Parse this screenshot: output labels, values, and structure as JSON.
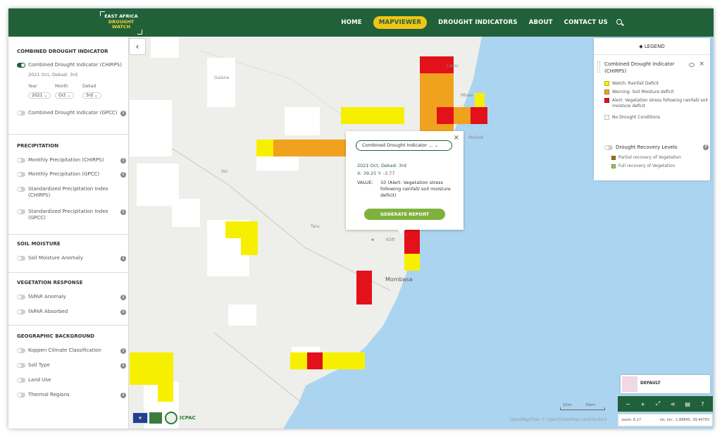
{
  "header": {
    "logo_line1": "EAST AFRICA",
    "logo_line2": "DROUGHT",
    "logo_line3": "WATCH",
    "nav": [
      "HOME",
      "MAPVIEWER",
      "DROUGHT INDICATORS",
      "ABOUT",
      "CONTACT US"
    ],
    "active_nav": "MAPVIEWER",
    "colors": {
      "header_bg": "#21613a",
      "active_bg": "#f2c416"
    }
  },
  "sidebar": {
    "sections": [
      {
        "title": "COMBINED DROUGHT INDICATOR",
        "layers": [
          {
            "label": "Combined Drought Indicator (CHIRPS)",
            "on": true,
            "sub": "2021 Oct, Dekad: 3rd"
          },
          {
            "label": "Combined Drought Indicator (GPCC)",
            "on": false
          }
        ]
      },
      {
        "title": "PRECIPITATION",
        "layers": [
          {
            "label": "Monthly Precipitation (CHIRPS)",
            "on": false
          },
          {
            "label": "Monthly Precipitation (GPCC)",
            "on": false
          },
          {
            "label": "Standardized Precipitation Index (CHIRPS)",
            "on": false
          },
          {
            "label": "Standardized Precipitation Index (GPCC)",
            "on": false
          }
        ]
      },
      {
        "title": "SOIL MOISTURE",
        "layers": [
          {
            "label": "Soil Moisture Anomaly",
            "on": false
          }
        ]
      },
      {
        "title": "VEGETATION RESPONSE",
        "layers": [
          {
            "label": "fAPAR Anomaly",
            "on": false
          },
          {
            "label": "fAPAR Absorbed",
            "on": false
          }
        ]
      },
      {
        "title": "GEOGRAPHIC BACKGROUND",
        "layers": [
          {
            "label": "Koppen Climate Classification",
            "on": false
          },
          {
            "label": "Soil Type",
            "on": false
          },
          {
            "label": "Land Use",
            "on": false
          },
          {
            "label": "Thermal Regions",
            "on": false
          }
        ]
      }
    ],
    "selectors": {
      "year_label": "Year",
      "year_value": "2021",
      "month_label": "Month",
      "month_value": "Oct",
      "dekad_label": "Dekad",
      "dekad_value": "3rd"
    },
    "footer": {
      "org": "ICPAC"
    }
  },
  "popup": {
    "select_value": "Combined Drought Indicator ...",
    "date": "2021 Oct, Dekad: 3rd",
    "xy": "X: 39.25  Y: -3.77",
    "value_label": "VALUE:",
    "value_text": "10   (Alert: Vegetation stress following rainfall/ soil moisture deficit)",
    "button": "GENERATE REPORT"
  },
  "legend": {
    "header": "LEGEND",
    "layer_title": "Combined Drought Indicator (CHIRPS)",
    "items": [
      {
        "label": "Watch: Rainfall Deficit",
        "color": "#f6f000"
      },
      {
        "label": "Warning: Soil Moisture deficit",
        "color": "#f0a21e"
      },
      {
        "label": "Alert: Vegetation stress following rainfall/ soil moisture deficit",
        "color": "#e3111a"
      },
      {
        "label": "No Drought Conditions",
        "color": "#ffffff"
      }
    ],
    "recovery_title": "Drought Recovery Levels",
    "recovery_items": [
      {
        "label": "Partial recovery of Vegetation",
        "color": "#9a7a16"
      },
      {
        "label": "Full recovery of Vegetation",
        "color": "#92c460"
      }
    ]
  },
  "map": {
    "places": [
      "Mombasa",
      "Malindi",
      "Lamu",
      "Kilifi",
      "Mbwe",
      "Taru",
      "Voi",
      "Galana"
    ],
    "attribution": "OpenMapTiles © OpenStreetMap contributors",
    "basemap_label": "DEFAULT",
    "zoom": "zoom: 6.17",
    "latlon": "lat, lon: -1.88845, 39.44755",
    "scale": [
      "15mi",
      "20km"
    ],
    "colors": {
      "land": "#eeefea",
      "sea": "#abd4f0",
      "watch": "#f6f000",
      "warning": "#f0a21e",
      "alert": "#e3111a"
    }
  }
}
